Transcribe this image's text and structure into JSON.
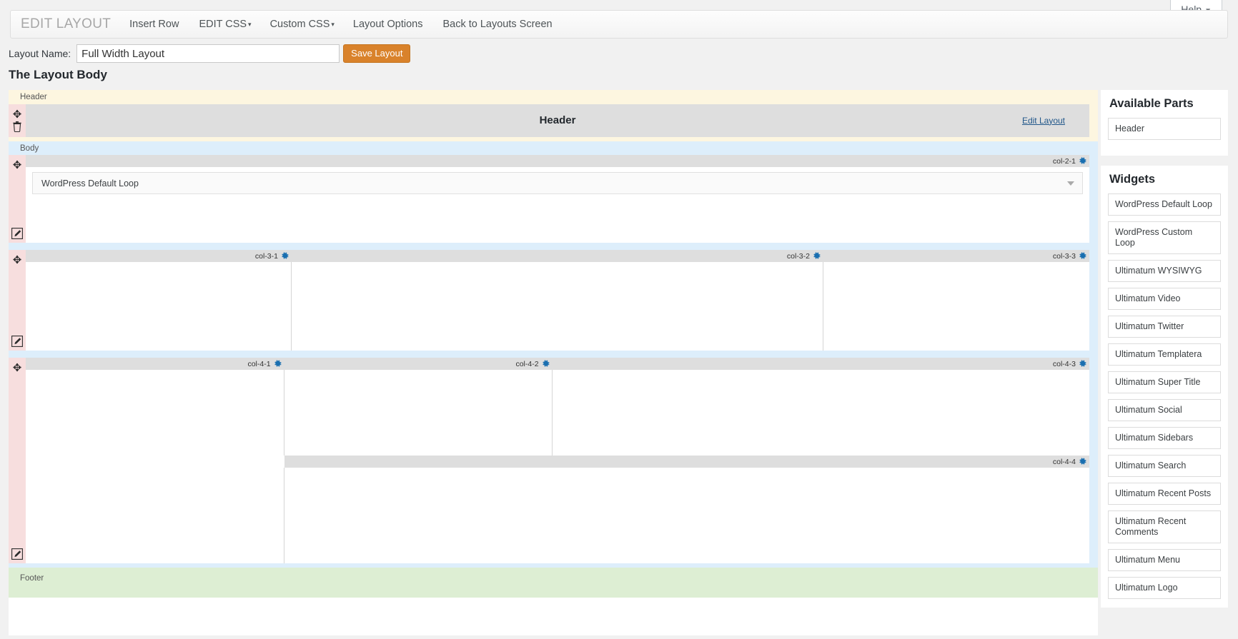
{
  "help": {
    "label": "Help",
    "caret": "▼"
  },
  "adminbar": {
    "brand": "EDIT LAYOUT",
    "items": [
      {
        "label": "Insert Row",
        "caret": ""
      },
      {
        "label": "EDIT CSS",
        "caret": "▾"
      },
      {
        "label": "Custom CSS",
        "caret": "▾"
      },
      {
        "label": "Layout Options",
        "caret": ""
      },
      {
        "label": "Back to Layouts Screen",
        "caret": ""
      }
    ]
  },
  "layout_name": {
    "label": "Layout Name:",
    "value": "Full Width Layout",
    "placeholder": "",
    "save_label": "Save Layout"
  },
  "section_title": "The Layout Body",
  "zones": {
    "header_label": "Header",
    "body_label": "Body",
    "footer_label": "Footer"
  },
  "header_row": {
    "title": "Header",
    "edit_link": "Edit Layout"
  },
  "rows": [
    {
      "name": "row-col-2",
      "columns": [
        {
          "label": "col-2-1"
        }
      ],
      "widget": "WordPress Default Loop"
    },
    {
      "name": "row-col-3",
      "columns": [
        {
          "label": "col-3-1"
        },
        {
          "label": "col-3-2"
        },
        {
          "label": "col-3-3"
        }
      ]
    },
    {
      "name": "row-col-4",
      "columns": [
        {
          "label": "col-4-1"
        },
        {
          "label": "col-4-2"
        },
        {
          "label": "col-4-3"
        },
        {
          "label": "col-4-4"
        }
      ]
    }
  ],
  "sidebar": {
    "available_parts": {
      "title": "Available Parts",
      "items": [
        "Header"
      ]
    },
    "widgets": {
      "title": "Widgets",
      "items": [
        "WordPress Default Loop",
        "WordPress Custom Loop",
        "Ultimatum WYSIWYG",
        "Ultimatum Video",
        "Ultimatum Twitter",
        "Ultimatum Templatera",
        "Ultimatum Super Title",
        "Ultimatum Social",
        "Ultimatum Sidebars",
        "Ultimatum Search",
        "Ultimatum Recent Posts",
        "Ultimatum Recent Comments",
        "Ultimatum Menu",
        "Ultimatum Logo"
      ]
    }
  },
  "colors": {
    "accent_orange": "#d9822b",
    "gear_blue": "#1a6fb0",
    "link_blue": "#21578a",
    "header_zone": "#fdf6e0",
    "body_zone": "#ddeefb",
    "footer_zone": "#ddeed3",
    "handle_pink": "#f7dede",
    "colbar_gray": "#dedede"
  }
}
